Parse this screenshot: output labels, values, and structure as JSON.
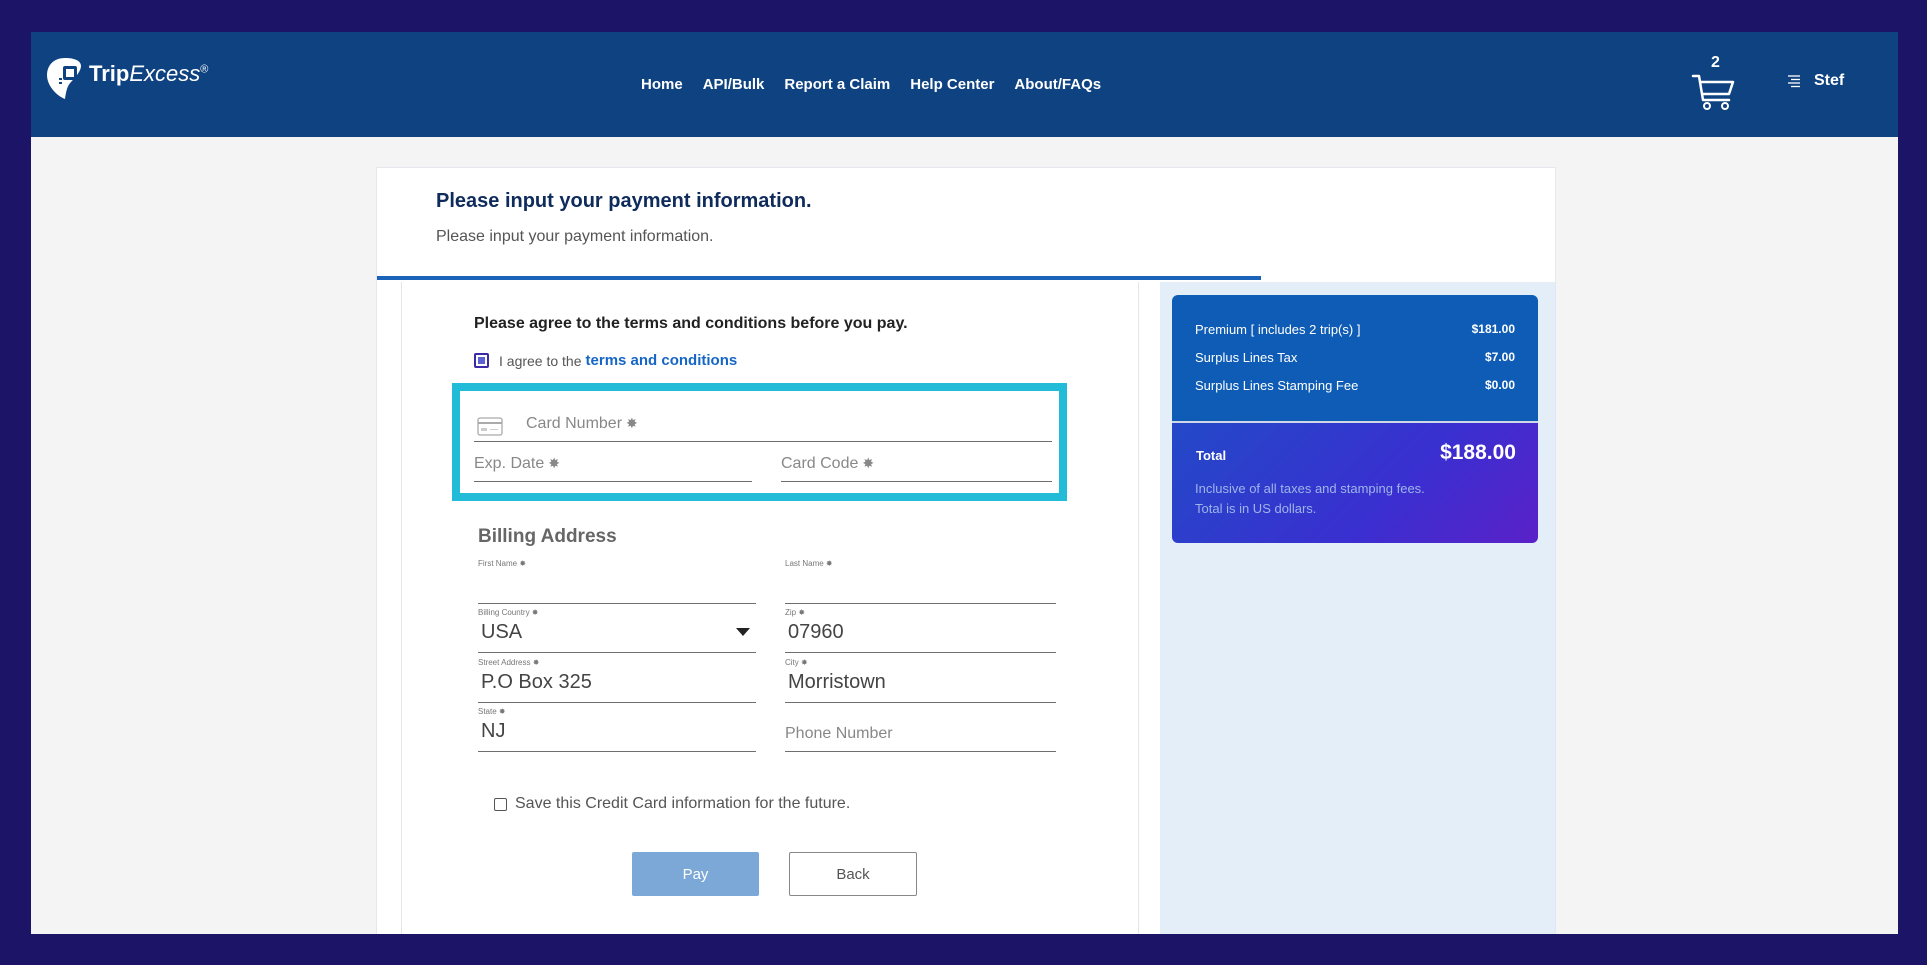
{
  "header": {
    "logo": {
      "brand_bold": "Trip",
      "brand_italic": "Excess",
      "reg_mark": "®"
    },
    "nav": [
      {
        "label": "Home"
      },
      {
        "label": "API/Bulk"
      },
      {
        "label": "Report a Claim"
      },
      {
        "label": "Help Center"
      },
      {
        "label": "About/FAQs"
      }
    ],
    "cart": {
      "count": "2",
      "icon": "cart-icon"
    },
    "user": {
      "name": "Stef",
      "icon": "menu-icon"
    }
  },
  "page": {
    "title": "Please input your payment information.",
    "subtitle": "Please input your payment information.",
    "progress": 0.75
  },
  "terms": {
    "heading": "Please agree to the terms and conditions before you pay.",
    "agree_prefix": "I agree to the",
    "agree_link": "terms and conditions",
    "checked": true
  },
  "payment": {
    "card_icon": "credit-card-icon",
    "card_number_placeholder": "Card Number",
    "exp_date_placeholder": "Exp. Date",
    "card_code_placeholder": "Card Code",
    "required_mark": "✸",
    "highlight_color": "#22bcd9"
  },
  "billing": {
    "title": "Billing Address",
    "first_name": {
      "label": "First Name",
      "value": ""
    },
    "last_name": {
      "label": "Last Name",
      "value": ""
    },
    "country": {
      "label": "Billing Country",
      "value": "USA"
    },
    "zip": {
      "label": "Zip",
      "value": "07960"
    },
    "street": {
      "label": "Street Address",
      "value": "P.O Box 325"
    },
    "city": {
      "label": "City",
      "value": "Morristown"
    },
    "state": {
      "label": "State",
      "value": "NJ"
    },
    "phone": {
      "placeholder": "Phone Number"
    }
  },
  "save_card": {
    "label": "Save this Credit Card information for the future.",
    "checked": false
  },
  "buttons": {
    "pay": "Pay",
    "back": "Back"
  },
  "summary": {
    "items": [
      {
        "label": "Premium [ includes 2 trip(s) ]",
        "amount": "$181.00"
      },
      {
        "label": "Surplus Lines Tax",
        "amount": "$7.00"
      },
      {
        "label": "Surplus Lines Stamping Fee",
        "amount": "$0.00"
      }
    ],
    "total_label": "Total",
    "total_amount": "$188.00",
    "note_line1": "Inclusive of all taxes and stamping fees.",
    "note_line2": "Total is in US dollars."
  }
}
